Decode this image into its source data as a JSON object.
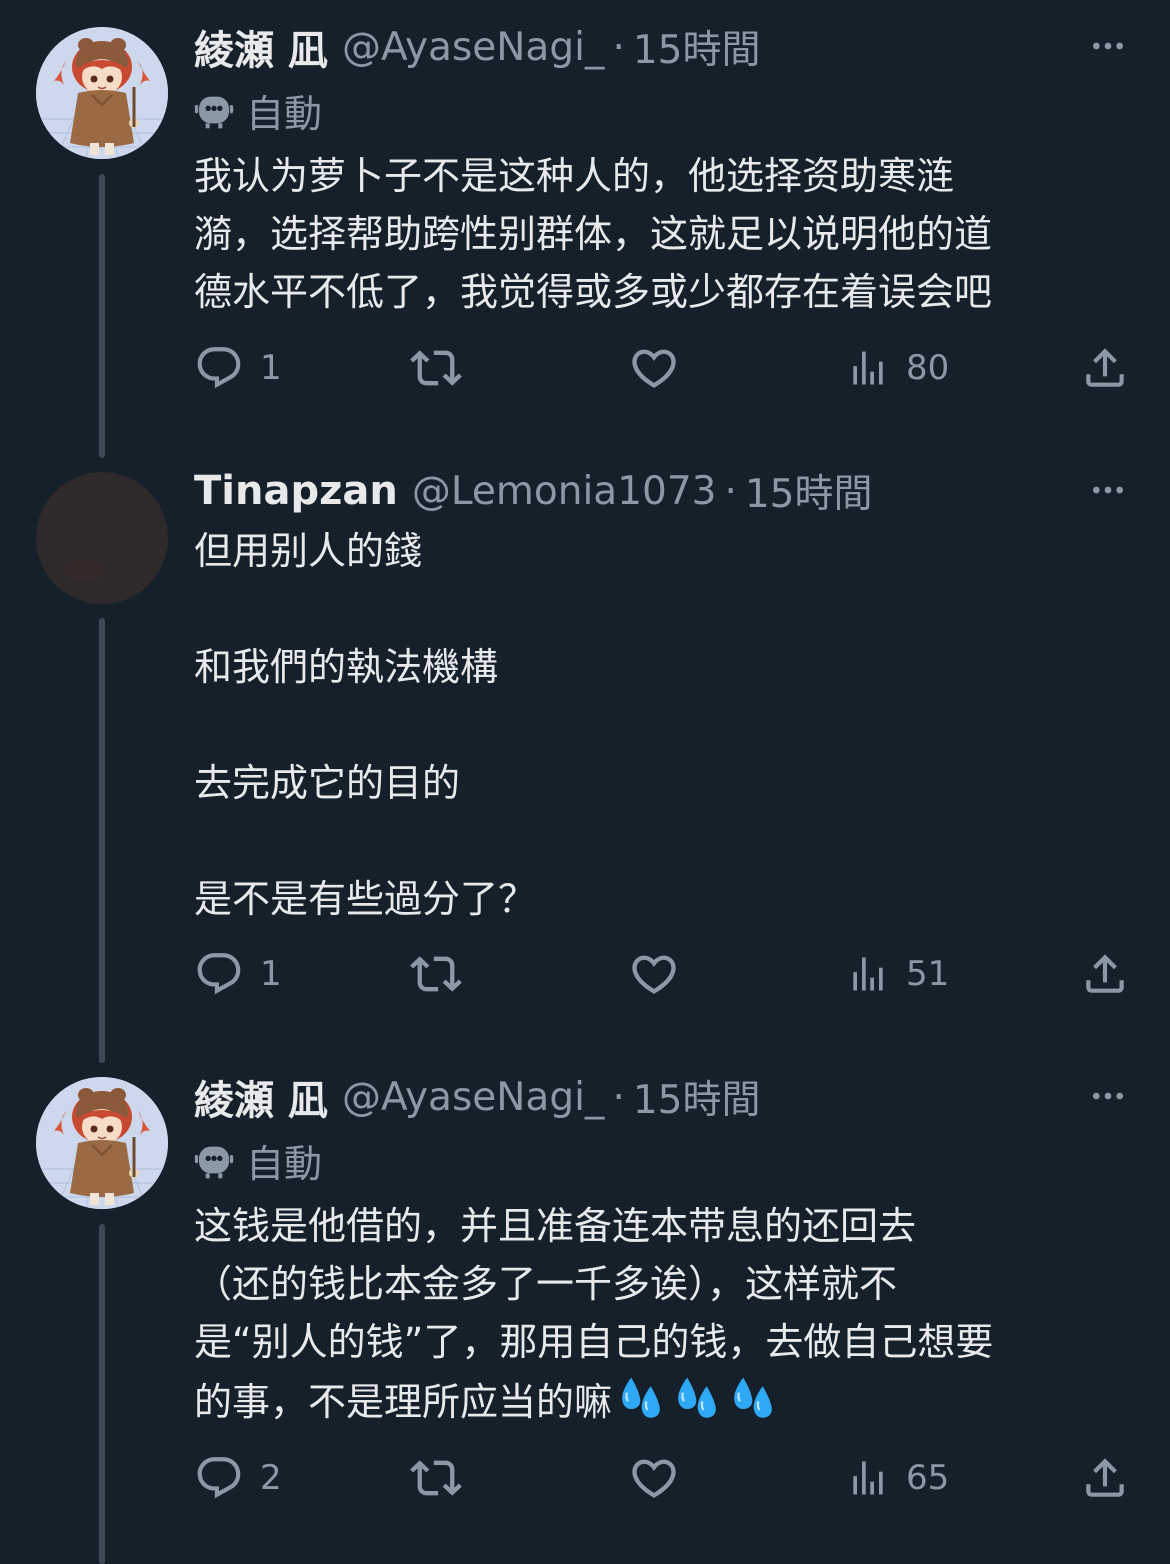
{
  "tweets": [
    {
      "display_name": "綾瀬 凪",
      "handle": "@AyaseNagi_",
      "separator": "·",
      "time": "15時間",
      "automated_label": "自動",
      "lines": [
        "我认为萝卜子不是这种人的，他选择资助寒涟",
        "漪，选择帮助跨性别群体，这就足以说明他的道",
        "德水平不低了，我觉得或多或少都存在着误会吧"
      ],
      "reply_count": "1",
      "views": "80",
      "avatar_icon": "anime-girl-avatar"
    },
    {
      "display_name": "Tinapzan",
      "handle": "@Lemonia1073",
      "separator": "·",
      "time": "15時間",
      "lines": [
        "但用别人的錢",
        "和我們的執法機構",
        "去完成它的目的",
        "是不是有些過分了？"
      ],
      "reply_count": "1",
      "views": "51",
      "avatar_icon": "dark-photo-avatar"
    },
    {
      "display_name": "綾瀬 凪",
      "handle": "@AyaseNagi_",
      "separator": "·",
      "time": "15時間",
      "automated_label": "自動",
      "lines": [
        "这钱是他借的，并且准备连本带息的还回去",
        "（还的钱比本金多了一千多诶），这样就不",
        "是“别人的钱”了，那用自己的钱，去做自己想要",
        "的事，不是理所应当的嘛"
      ],
      "emoji": [
        "sweat-droplets-emoji",
        "sweat-droplets-emoji",
        "sweat-droplets-emoji"
      ],
      "reply_count": "2",
      "views": "65",
      "avatar_icon": "anime-girl-avatar"
    }
  ],
  "icons": {
    "reply": "reply-icon",
    "retweet": "retweet-icon",
    "like": "like-icon",
    "views": "views-icon",
    "share": "share-icon",
    "more": "more-icon",
    "automated": "robot-icon"
  },
  "colors": {
    "background": "#15202b",
    "text_primary": "#e7e9ea",
    "text_secondary": "#8b98a5",
    "thread_line": "#3d4955",
    "emoji_blue": "#2fa9f5"
  }
}
